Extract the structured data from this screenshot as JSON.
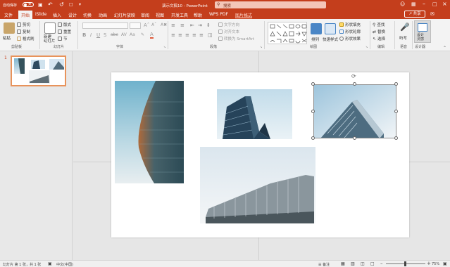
{
  "titlebar": {
    "autosave_label": "自动保存",
    "toggle_label": "关",
    "doc_title": "演示文稿10 - PowerPoint",
    "search_placeholder": "搜索",
    "colors": {
      "bg": "#c43e1c"
    }
  },
  "tabs": [
    "文件",
    "开始",
    "iSlide",
    "插入",
    "设计",
    "切换",
    "动画",
    "幻灯片放映",
    "审阅",
    "视图",
    "开发工具",
    "帮助",
    "WPS PDF",
    "图片格式"
  ],
  "share_label": "共享",
  "ribbon": {
    "paste": "粘贴",
    "cut": "剪切",
    "copy": "复制",
    "format_painter": "格式刷",
    "clipboard": "剪贴板",
    "new_slide": "新建\n幻灯片",
    "layout": "版式",
    "reset": "重置",
    "section": "节",
    "slides": "幻灯片",
    "font": "字体",
    "text_direction": "文字方向",
    "align_text": "对齐文本",
    "smartart": "转换为 SmartArt",
    "paragraph": "段落",
    "arrange": "排列",
    "quick_styles": "快速样式",
    "shape_fill": "形状填充",
    "shape_outline": "形状轮廓",
    "shape_effects": "形状效果",
    "drawing": "绘图",
    "find": "查找",
    "replace": "替换",
    "select": "选择",
    "editing": "编辑",
    "dictate": "听写",
    "voice": "语音",
    "designer": "设计\n灵感",
    "designer_group": "设计器"
  },
  "thumbnail_number": "1",
  "status": {
    "slide_info": "幻灯片 第 1 张，共 1 张",
    "language": "中文(中国)",
    "notes": "备注",
    "zoom": "75%"
  }
}
